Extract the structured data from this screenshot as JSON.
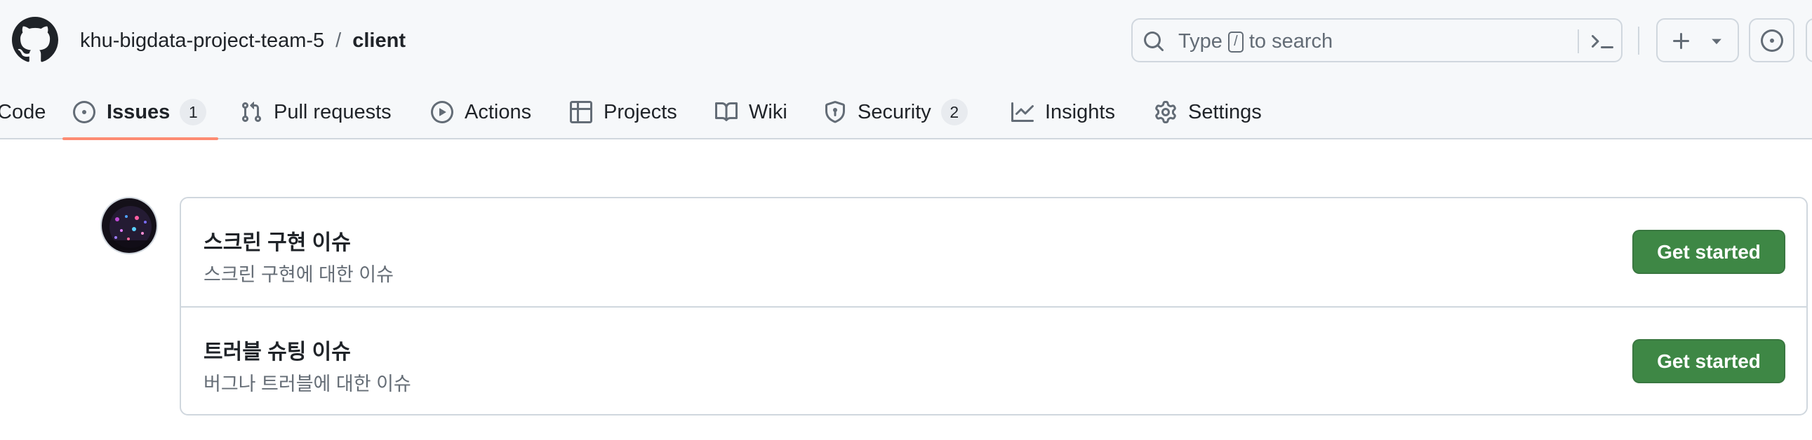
{
  "colors": {
    "header_bg": "#f6f8fa",
    "border": "#d0d7de",
    "tab_underline": "#fd8c73",
    "button_green": "#3e8745",
    "muted_text": "#656d76"
  },
  "header": {
    "owner": "khu-bigdata-project-team-5",
    "separator": "/",
    "repo": "client",
    "search": {
      "prefix": "Type",
      "key": "/",
      "suffix": "to search"
    },
    "icons": [
      "github-logo",
      "search-icon",
      "command-palette-icon",
      "plus-icon",
      "triangle-down-icon",
      "issue-opened-icon"
    ]
  },
  "nav": {
    "tabs": [
      {
        "label": "Code",
        "icon": "code-icon"
      },
      {
        "label": "Issues",
        "icon": "issue-opened-icon",
        "counter": "1",
        "selected": true
      },
      {
        "label": "Pull requests",
        "icon": "git-pull-request-icon"
      },
      {
        "label": "Actions",
        "icon": "play-icon"
      },
      {
        "label": "Projects",
        "icon": "table-icon"
      },
      {
        "label": "Wiki",
        "icon": "book-icon"
      },
      {
        "label": "Security",
        "icon": "shield-icon",
        "counter": "2"
      },
      {
        "label": "Insights",
        "icon": "graph-icon"
      },
      {
        "label": "Settings",
        "icon": "gear-icon"
      }
    ]
  },
  "templates": {
    "items": [
      {
        "title": "스크린 구현 이슈",
        "description": "스크린 구현에 대한 이슈",
        "button": "Get started"
      },
      {
        "title": "트러블 슈팅 이슈",
        "description": "버그나 트러블에 대한 이슈",
        "button": "Get started"
      }
    ]
  }
}
